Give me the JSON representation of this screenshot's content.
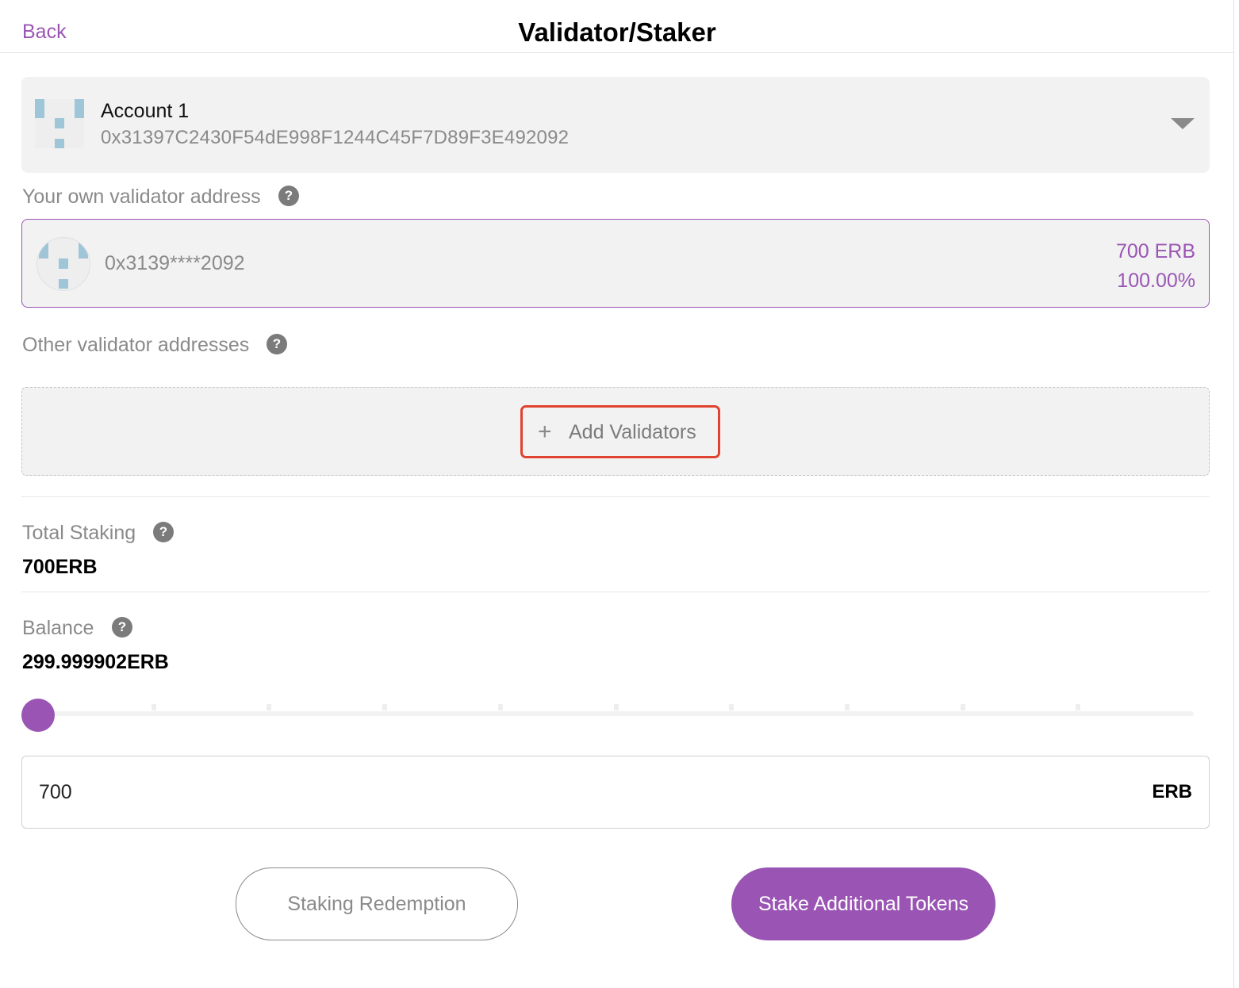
{
  "header": {
    "back_label": "Back",
    "title": "Validator/Staker"
  },
  "account": {
    "name": "Account 1",
    "address": "0x31397C2430F54dE998F1244C45F7D89F3E492092",
    "avatar_icon": "identicon",
    "dropdown_icon": "caret-down-icon"
  },
  "own_validator": {
    "label": "Your own validator address",
    "help_icon": "?",
    "address": "0x3139****2092",
    "amount": "700 ERB",
    "percent": "100.00%"
  },
  "other_validators": {
    "label": "Other validator addresses",
    "help_icon": "?",
    "add_icon": "+",
    "add_label": "Add Validators"
  },
  "total_staking": {
    "label": "Total Staking",
    "help_icon": "?",
    "value": "700ERB"
  },
  "balance": {
    "label": "Balance",
    "help_icon": "?",
    "value": "299.999902ERB"
  },
  "slider": {
    "value_fraction": 0,
    "tick_count": 10
  },
  "amount_input": {
    "value": "700",
    "unit": "ERB"
  },
  "actions": {
    "redeem_label": "Staking Redemption",
    "stake_label": "Stake Additional Tokens"
  },
  "colors": {
    "accent": "#9a55b4",
    "highlight_border": "#e0432f",
    "muted_text": "#8a8a8a"
  }
}
